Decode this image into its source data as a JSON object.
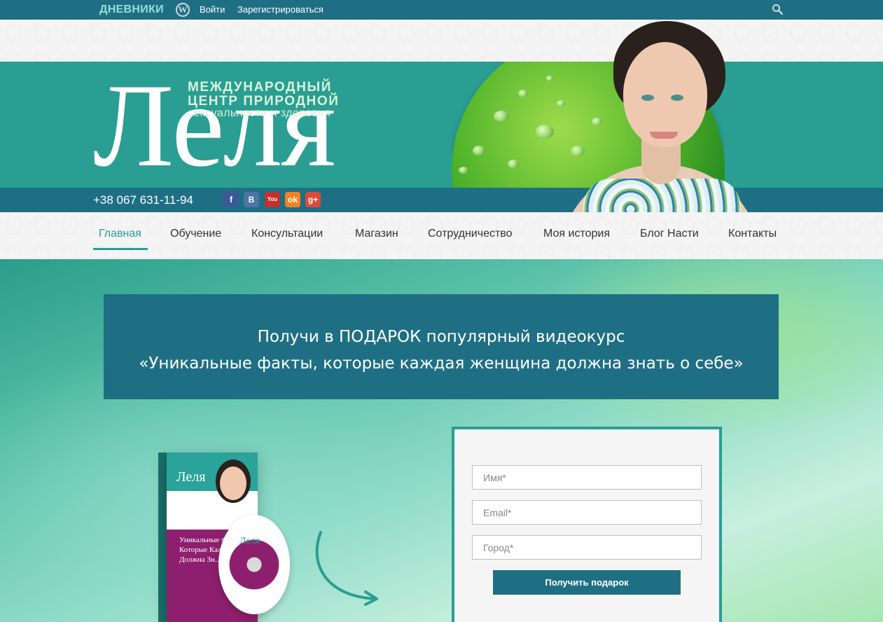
{
  "topbar": {
    "brand": "ДНЕВНИКИ",
    "login": "Войти",
    "register": "Зарегистрироваться",
    "wp_icon": "wordpress-icon",
    "search_icon": "search-icon"
  },
  "logo": {
    "name": "Леля",
    "line1": "МЕЖДУНАРОДНЫЙ",
    "line2": "ЦЕНТР ПРИРОДНОЙ",
    "line3": "сексуальности и здоровья"
  },
  "contact": {
    "phone": "+38 067 631-11-94",
    "social": [
      {
        "name": "facebook-icon",
        "glyph": "f",
        "color": "#3b5998"
      },
      {
        "name": "vkontakte-icon",
        "glyph": "B",
        "color": "#4c75a3"
      },
      {
        "name": "youtube-icon",
        "glyph": "You",
        "color": "#c4302b"
      },
      {
        "name": "odnoklassniki-icon",
        "glyph": "ok",
        "color": "#f58220"
      },
      {
        "name": "google-plus-icon",
        "glyph": "g+",
        "color": "#dd4b39"
      }
    ]
  },
  "nav": {
    "items": [
      "Главная",
      "Обучение",
      "Консультации",
      "Магазин",
      "Сотрудничество",
      "Моя история",
      "Блог Насти",
      "Контакты"
    ],
    "active": 0
  },
  "banner": {
    "line1": "Получи в ПОДАРОК популярный видеокурс",
    "line2": "«Уникальные факты, которые каждая женщина должна знать о себе»"
  },
  "product": {
    "box_logo": "Леля",
    "box_text": "Уникальные Ф... Которые Каж... Должна Зн...",
    "disc_logo": "Леля"
  },
  "form": {
    "name_placeholder": "Имя*",
    "email_placeholder": "Email*",
    "city_placeholder": "Город*",
    "submit": "Получить подарок"
  },
  "colors": {
    "teal": "#2a9e93",
    "dark_teal": "#1f6f84",
    "purple": "#8d1f6e"
  }
}
